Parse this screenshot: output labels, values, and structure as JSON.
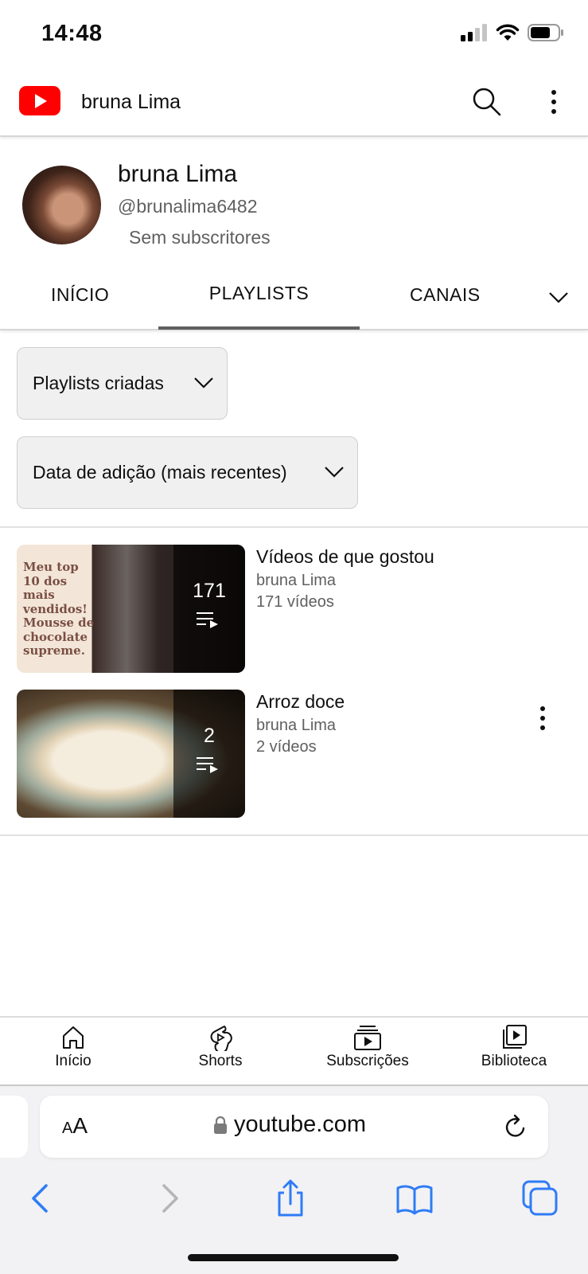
{
  "status_bar": {
    "time": "14:48"
  },
  "header": {
    "title": "bruna Lima"
  },
  "channel": {
    "name": "bruna Lima",
    "handle": "@brunalima6482",
    "subscribers": "Sem subscritores"
  },
  "tabs": [
    {
      "label": "INÍCIO"
    },
    {
      "label": "PLAYLISTS"
    },
    {
      "label": "CANAIS"
    }
  ],
  "filters": {
    "type": "Playlists criadas",
    "sort": "Data de adição (mais recentes)"
  },
  "playlists": [
    {
      "thumb_text": "Meu top 10 dos mais vendidos! Mousse de chocolate supreme.",
      "count": "171",
      "title": "Vídeos de que gostou",
      "owner": "bruna Lima",
      "videos": "171 vídeos"
    },
    {
      "count": "2",
      "title": "Arroz doce",
      "owner": "bruna Lima",
      "videos": "2 vídeos"
    }
  ],
  "bottom_nav": [
    {
      "label": "Início"
    },
    {
      "label": "Shorts"
    },
    {
      "label": "Subscrições"
    },
    {
      "label": "Biblioteca"
    }
  ],
  "browser": {
    "text_size_button": "AA",
    "url": "youtube.com"
  },
  "colors": {
    "youtube_red": "#ff0000",
    "ios_blue": "#2f7cf6",
    "secondary_text": "#606060"
  }
}
